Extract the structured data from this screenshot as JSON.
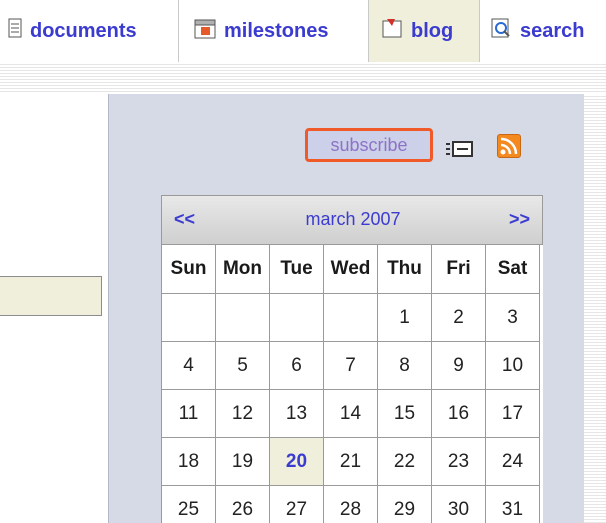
{
  "nav": {
    "tabs": [
      {
        "label": "documents",
        "icon": "document-icon"
      },
      {
        "label": "milestones",
        "icon": "calendar-icon"
      },
      {
        "label": "blog",
        "icon": "blog-icon",
        "active": true
      },
      {
        "label": "search",
        "icon": "search-icon"
      }
    ]
  },
  "sidebar": {
    "subscribe_label": "subscribe",
    "email_icon": "envelope-icon",
    "rss_icon": "rss-icon"
  },
  "calendar": {
    "prev_label": "<<",
    "month_label": "march 2007",
    "next_label": ">>",
    "weekdays": [
      "Sun",
      "Mon",
      "Tue",
      "Wed",
      "Thu",
      "Fri",
      "Sat"
    ],
    "weeks": [
      [
        "",
        "",
        "",
        "",
        "1",
        "2",
        "3"
      ],
      [
        "4",
        "5",
        "6",
        "7",
        "8",
        "9",
        "10"
      ],
      [
        "11",
        "12",
        "13",
        "14",
        "15",
        "16",
        "17"
      ],
      [
        "18",
        "19",
        "20",
        "21",
        "22",
        "23",
        "24"
      ],
      [
        "25",
        "26",
        "27",
        "28",
        "29",
        "30",
        "31"
      ]
    ],
    "today": "20"
  },
  "colors": {
    "link": "#3b3bd0",
    "sidebar_bg": "#d6d9e6",
    "highlight": "#efefdc",
    "subscribe_border": "#f05a28"
  }
}
